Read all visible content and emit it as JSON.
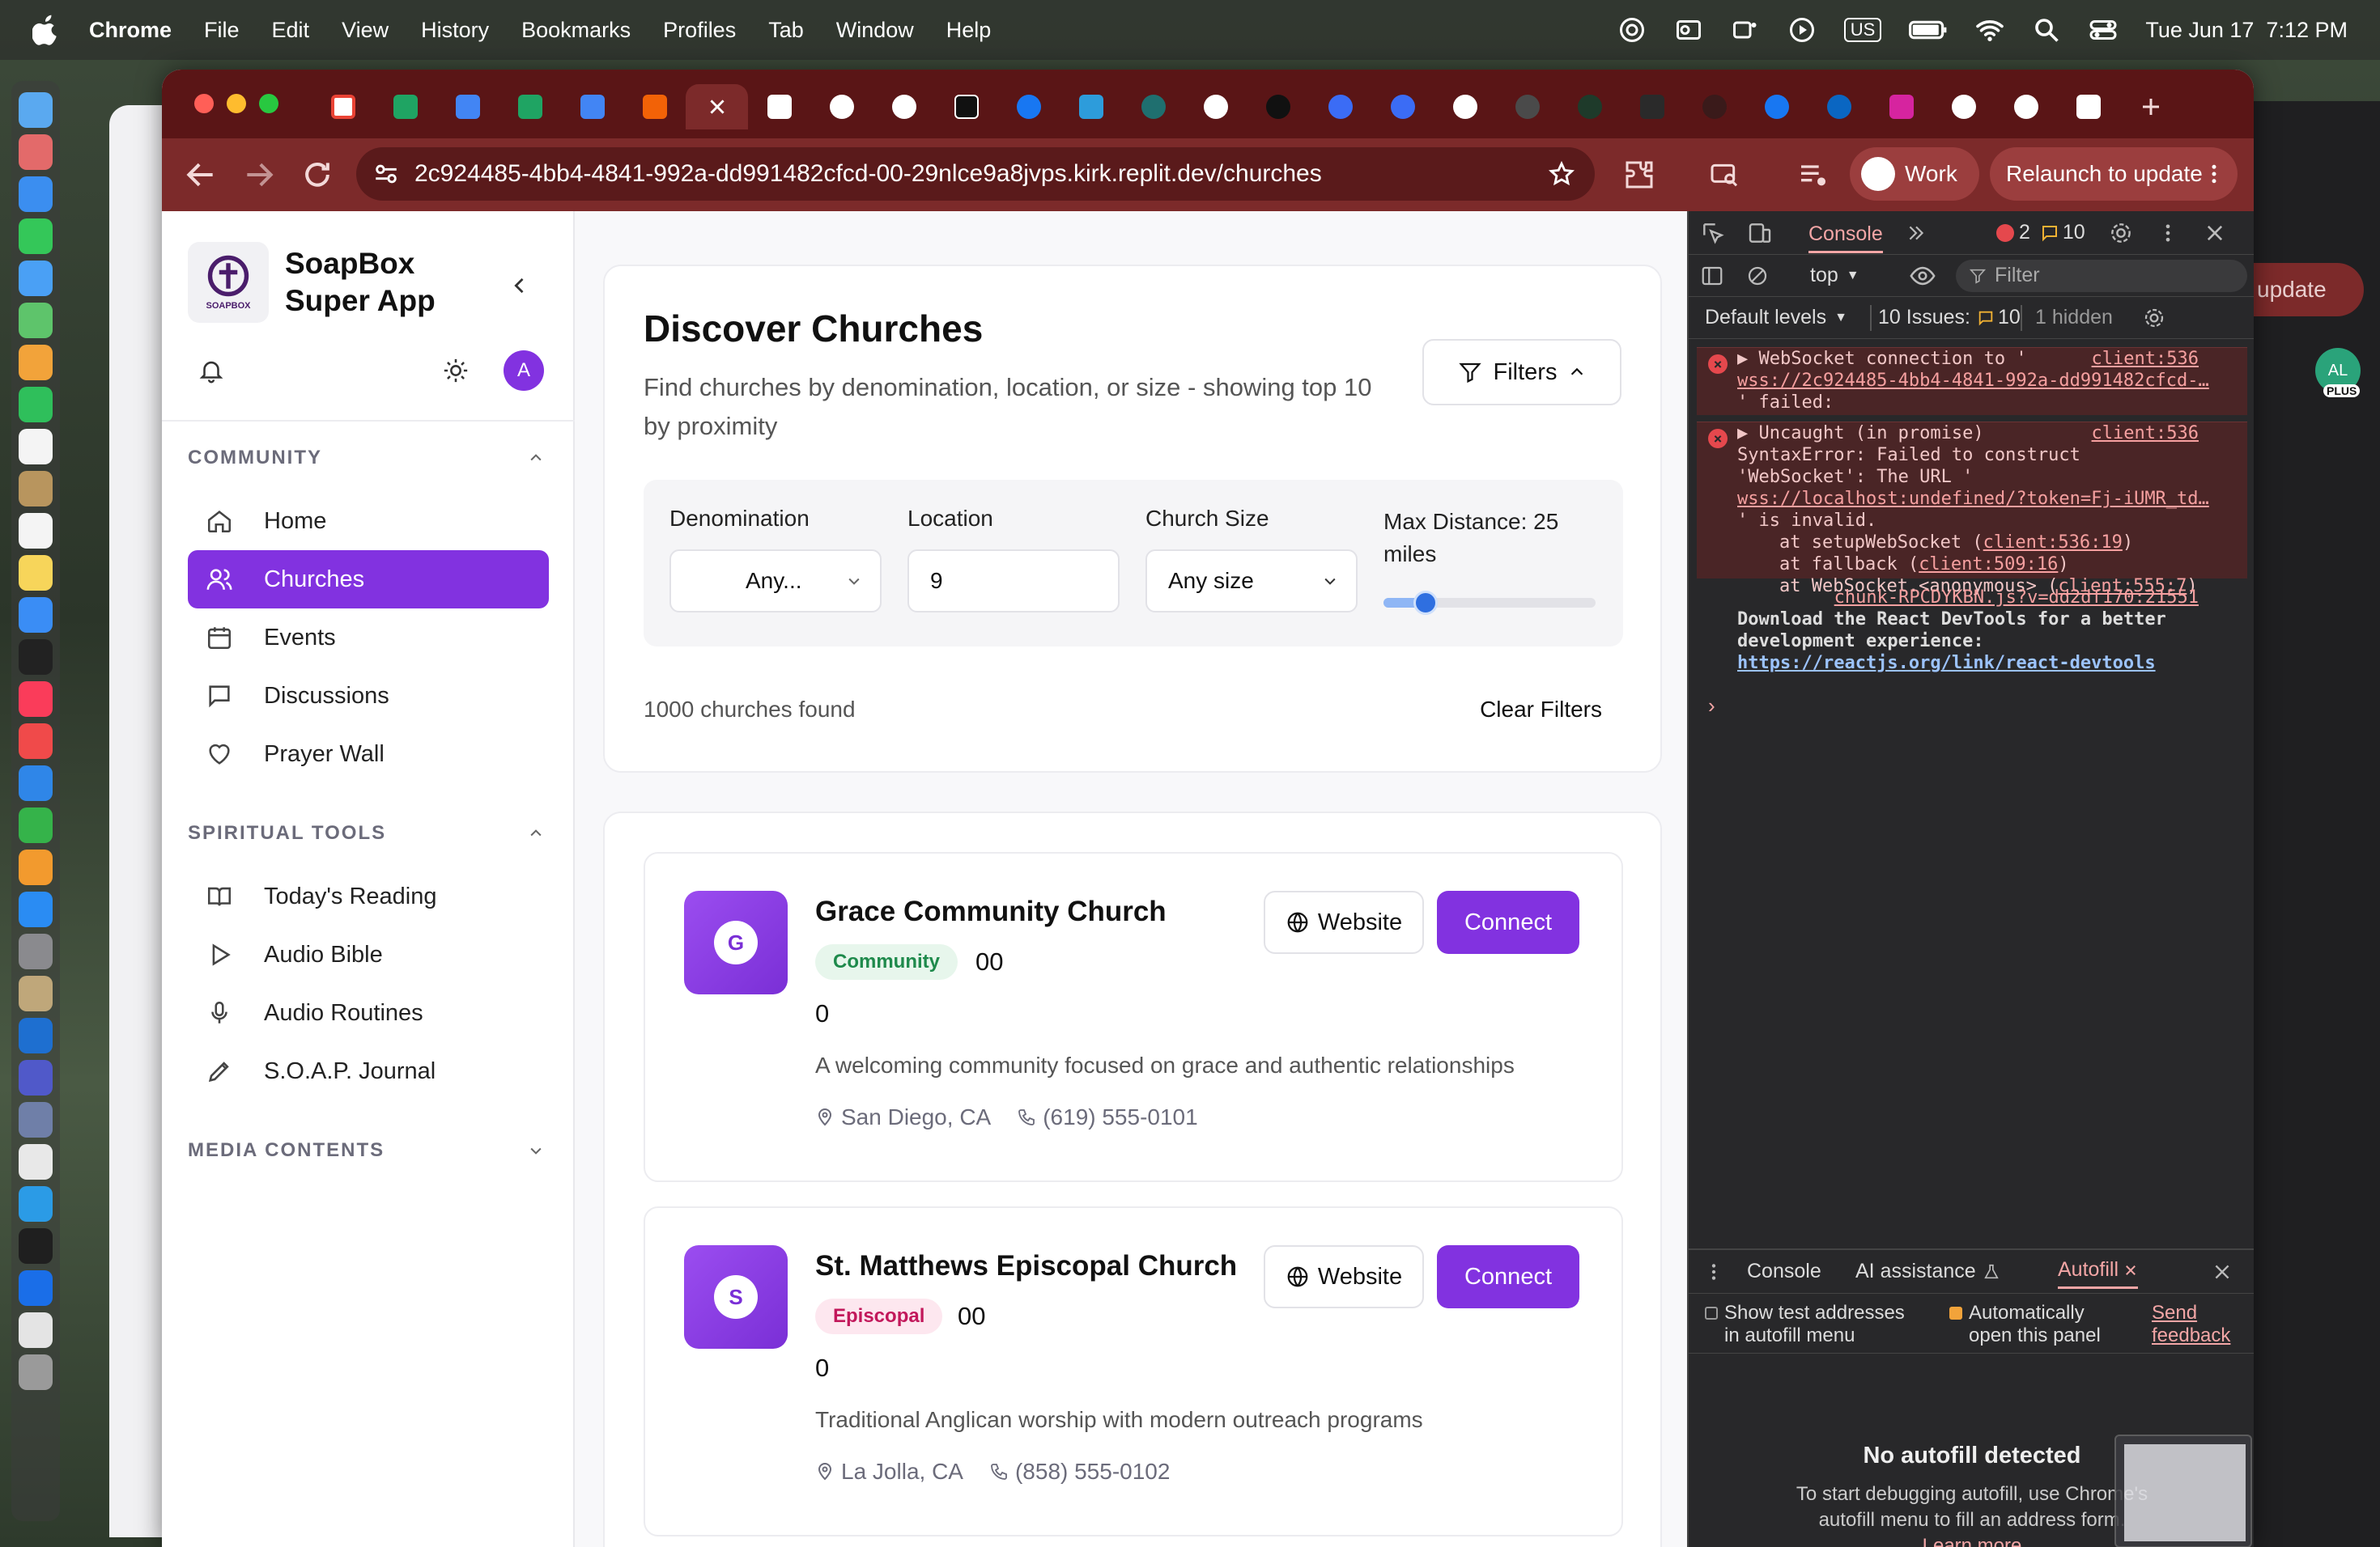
{
  "menubar": {
    "app": "Chrome",
    "items": [
      "File",
      "Edit",
      "View",
      "History",
      "Bookmarks",
      "Profiles",
      "Tab",
      "Window",
      "Help"
    ],
    "input_source": "US",
    "datetime": "Tue Jun 17  7:12 PM"
  },
  "toolbar": {
    "url": "2c924485-4bb4-4841-992a-dd991482cfcd-00-29nlce9a8jvps.kirk.replit.dev/churches",
    "profile_label": "Work",
    "relaunch_label": "Relaunch to update",
    "behind_window_label": "update",
    "behind_avatar": "AL",
    "behind_badge": "PLUS"
  },
  "sidebar": {
    "logo_text": "SOAPBOX",
    "app_name_line1": "SoapBox",
    "app_name_line2": "Super App",
    "user_initial": "A",
    "section_community": "COMMUNITY",
    "community_items": [
      {
        "label": "Home",
        "icon": "home-icon"
      },
      {
        "label": "Churches",
        "icon": "users-icon"
      },
      {
        "label": "Events",
        "icon": "calendar-icon"
      },
      {
        "label": "Discussions",
        "icon": "message-icon"
      },
      {
        "label": "Prayer Wall",
        "icon": "heart-icon"
      }
    ],
    "section_spiritual": "SPIRITUAL TOOLS",
    "spiritual_items": [
      {
        "label": "Today's Reading",
        "icon": "book-icon"
      },
      {
        "label": "Audio Bible",
        "icon": "play-icon"
      },
      {
        "label": "Audio Routines",
        "icon": "mic-icon"
      },
      {
        "label": "S.O.A.P. Journal",
        "icon": "pen-icon"
      }
    ],
    "section_media": "MEDIA CONTENTS"
  },
  "discover": {
    "title": "Discover Churches",
    "subtitle_line1": "Find churches by denomination, location, or size - showing top 10",
    "subtitle_line2": "by proximity",
    "filters_label": "Filters",
    "denomination_label": "Denomination",
    "denomination_value": "Any...",
    "location_label": "Location",
    "location_value": "9",
    "size_label": "Church Size",
    "size_value": "Any size",
    "distance_label_line1": "Max Distance: 25",
    "distance_label_line2": "miles",
    "distance_fraction": 0.2,
    "count_text": "1000 churches found",
    "clear_label": "Clear Filters"
  },
  "churches": [
    {
      "initial": "G",
      "name": "Grace Community Church",
      "badge": "Community",
      "badge_color": "#e7f6ec",
      "badge_text_color": "#1f8a4c",
      "extra1": "00",
      "extra2": "0",
      "description": "A welcoming community focused on grace and authentic relationships",
      "location": "San Diego, CA",
      "phone": "(619) 555-0101",
      "website_label": "Website",
      "connect_label": "Connect"
    },
    {
      "initial": "S",
      "name": "St. Matthews Episcopal Church",
      "badge": "Episcopal",
      "badge_color": "#fde7ef",
      "badge_text_color": "#c2185b",
      "extra1": "00",
      "extra2": "0",
      "description": "Traditional Anglican worship with modern outreach programs",
      "location": "La Jolla, CA",
      "phone": "(858) 555-0102",
      "website_label": "Website",
      "connect_label": "Connect"
    }
  ],
  "devtools": {
    "tab_console": "Console",
    "error_count": "2",
    "warn_count": "10",
    "context": "top",
    "filter_placeholder": "Filter",
    "levels": "Default levels",
    "issues": "10 Issues:",
    "issues_count": "10",
    "hidden": "1 hidden",
    "err1_src": "client:536",
    "err1_line1": "WebSocket connection to '",
    "err1_link": "wss://2c924485-4bb4-4841-992a-dd991482cfcd-…",
    "err1_line3": "' failed:",
    "err2_src": "client:536",
    "err2_line1": "Uncaught (in promise)",
    "err2_line2": "SyntaxError: Failed to construct",
    "err2_line3": "'WebSocket': The URL '",
    "err2_link": "wss://localhost:undefined/?token=Fj-iUMR_td…",
    "err2_line5": "' is invalid.",
    "err2_at1": "at setupWebSocket (",
    "err2_at1_link": "client:536:19",
    "err2_at2": "at fallback (",
    "err2_at2_link": "client:509:16",
    "err2_at3": "at WebSocket.<anonymous> (",
    "err2_at3_link": "client:555:7",
    "info_src": "chunk-RPCDYKBN.js?v=dd2df170:21551",
    "info_line1": "Download the React DevTools for a better",
    "info_line2": "development experience:",
    "info_link": "https://reactjs.org/link/react-devtools",
    "drawer_console": "Console",
    "drawer_ai": "AI assistance",
    "drawer_autofill": "Autofill",
    "opt1_line1": "Show test addresses",
    "opt1_line2": "in autofill menu",
    "opt2_line1": "Automatically",
    "opt2_line2": "open this panel",
    "send1": "Send",
    "send2": "feedback",
    "no_autofill": "No autofill detected",
    "no_autofill_desc1": "To start debugging autofill, use Chrome's",
    "no_autofill_desc2": "autofill menu to fill an address form.",
    "learn_more": "Learn more"
  }
}
